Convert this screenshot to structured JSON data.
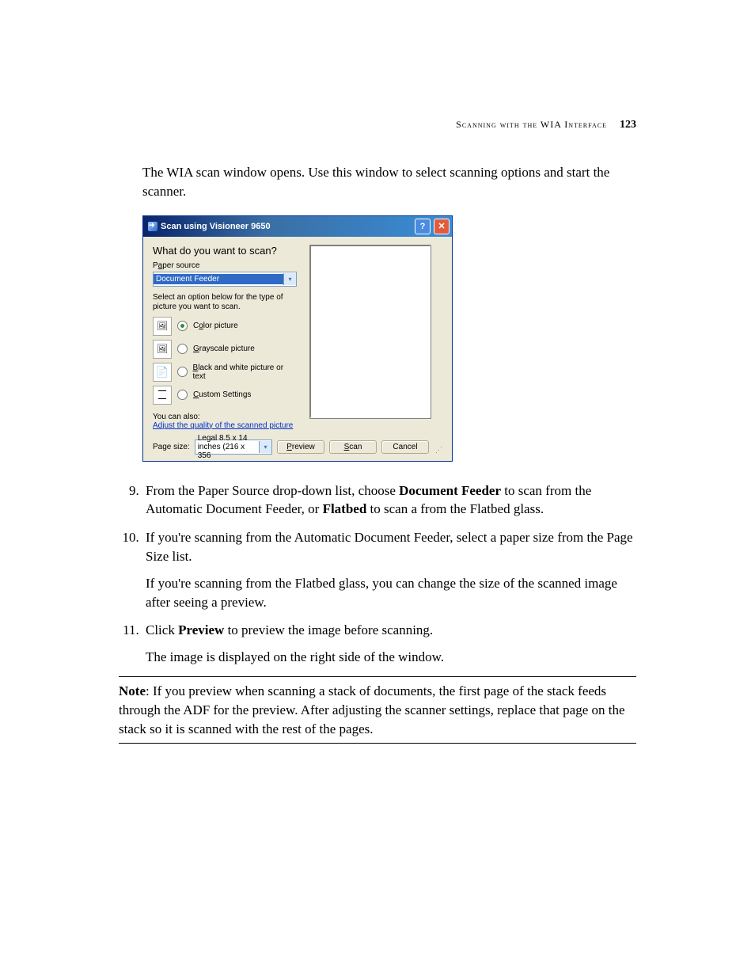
{
  "header": {
    "section": "Scanning with the WIA Interface",
    "page_number": "123"
  },
  "intro": "The WIA scan window opens. Use this window to select scanning options and start the scanner.",
  "dialog": {
    "title": "Scan using Visioneer 9650",
    "heading": "What do you want to scan?",
    "paper_source_label": "Paper source",
    "paper_source_value": "Document Feeder",
    "select_instruction": "Select an option below for the type of picture you want to scan.",
    "options": {
      "color": "Color picture",
      "gray": "Grayscale picture",
      "bw": "Black and white picture or text",
      "custom": "Custom Settings"
    },
    "you_can_also": "You can also:",
    "adjust_link": "Adjust the quality of the scanned picture",
    "page_size_label": "Page size:",
    "page_size_value": "Legal 8.5 x 14 inches (216 x 356",
    "buttons": {
      "preview": "Preview",
      "scan": "Scan",
      "cancel": "Cancel"
    }
  },
  "steps": {
    "s9a": "From the Paper Source drop-down list, choose ",
    "s9b": "Document Feeder",
    "s9c": " to scan from the Automatic Document Feeder, or ",
    "s9d": "Flatbed",
    "s9e": " to scan a from the Flatbed glass.",
    "s10a": "If you're scanning from the Automatic Document Feeder, select a paper size from the Page Size list.",
    "s10b": "If you're scanning from the Flatbed glass, you can change the size of the scanned image after seeing a preview.",
    "s11a": "Click ",
    "s11b": "Preview",
    "s11c": " to preview the image before scanning.",
    "s11d": "The image is displayed on the right side of the window."
  },
  "note": {
    "label": "Note",
    "text": ":  If you preview when scanning a stack of documents, the first page of the stack feeds through the ADF for the preview. After adjusting the scanner settings, replace that page on the stack so it is scanned with the rest of the pages."
  }
}
